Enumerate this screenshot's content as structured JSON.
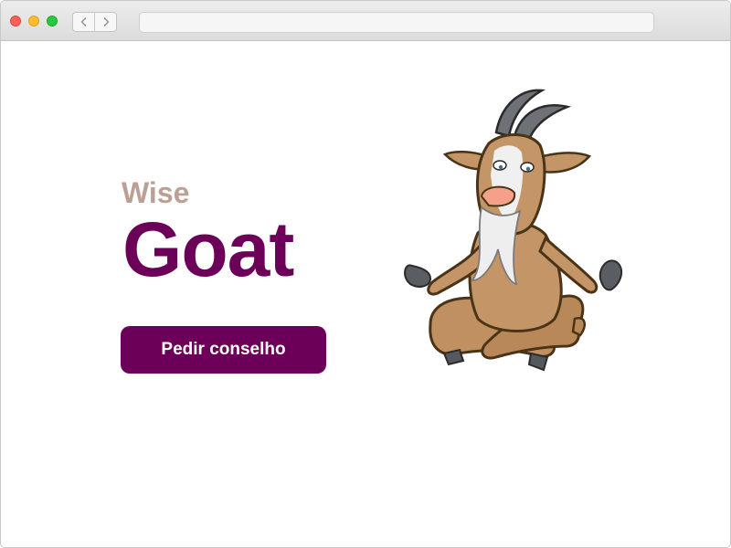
{
  "browser": {
    "back_icon": "chevron-left-icon",
    "forward_icon": "chevron-right-icon",
    "address": ""
  },
  "hero": {
    "subtitle": "Wise",
    "title": "Goat",
    "cta_label": "Pedir conselho"
  },
  "colors": {
    "brand": "#6c0059",
    "subtitle": "#bba093"
  },
  "illustration": {
    "icon": "meditating-goat-illustration"
  }
}
